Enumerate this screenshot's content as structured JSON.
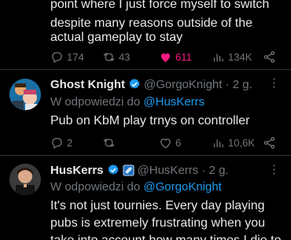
{
  "tweet1": {
    "text_lines": [
      "point where I just force myself to switch",
      "despite many reasons outside of the",
      "actual gameplay to stay"
    ],
    "actions": {
      "replies": "174",
      "retweets": "43",
      "likes": "611",
      "views": "134K"
    },
    "colors": {
      "like_active": "#f91880"
    }
  },
  "tweet2": {
    "display_name": "Ghost Knight",
    "handle_time": "@GorgoKnight · 2 g.",
    "reply_prefix": "W odpowiedzi do",
    "reply_target": "@HusKerrs",
    "text_lines": [
      "Pub on KbM play trnys on controller"
    ],
    "actions": {
      "replies": "2",
      "retweets": "",
      "likes": "6",
      "views": "10,6K"
    },
    "icons": {
      "verified": "verified-badge-icon"
    }
  },
  "tweet3": {
    "display_name": "HusKerrs",
    "handle_time": "@HusKerrs · 2 g.",
    "reply_prefix": "W odpowiedzi do",
    "reply_target": "@GorgoKnight",
    "text_lines": [
      "It's not just tournies. Every day playing",
      "pubs is extremely frustrating when you",
      "take into account how many times I die to"
    ],
    "icons": {
      "verified": "verified-badge-icon",
      "affiliate": "affiliate-badge-icon"
    }
  },
  "colors": {
    "accent": "#1d9bf0",
    "muted": "#71767b",
    "text": "#e7e9ea",
    "divider": "#2f3336"
  }
}
